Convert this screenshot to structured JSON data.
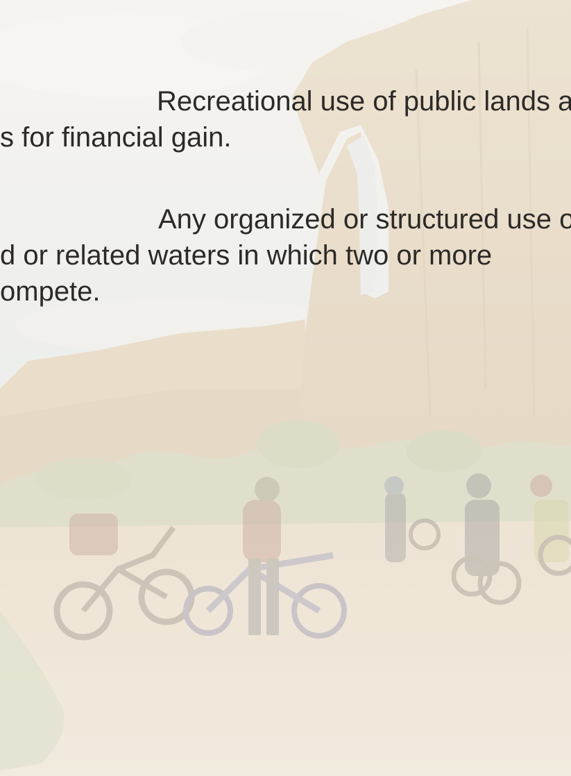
{
  "slide": {
    "paragraphs": [
      {
        "lines": [
          "Recreational use of public lands and",
          "s for financial gain."
        ]
      },
      {
        "lines": [
          "Any organized or structured use or event",
          "d or related waters in which two or more",
          "ompete."
        ]
      }
    ]
  },
  "background": {
    "description_icon": "desert-canyon-dirt-bikes-photo",
    "colors": {
      "sky": "#eef1f2",
      "cliff": "#e2d2b8",
      "ground": "#ece2d3",
      "brush": "#cfd2b6",
      "text": "#2c2a27"
    }
  }
}
